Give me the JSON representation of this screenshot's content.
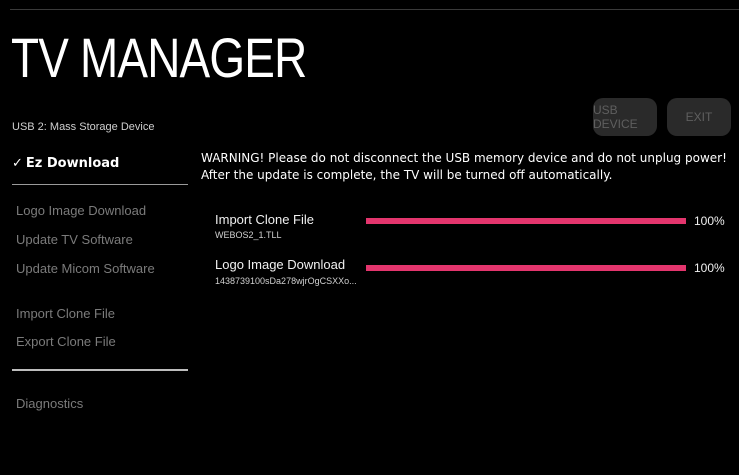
{
  "header": {
    "title": "TV MANAGER",
    "subtitle": "USB 2: Mass Storage Device"
  },
  "buttons": {
    "usb_device": "USB DEVICE",
    "exit": "EXIT"
  },
  "sidebar": {
    "active": {
      "check": "✓",
      "label": "Ez Download"
    },
    "items": [
      "Logo Image Download",
      "Update TV Software",
      "Update Micom Software",
      "Import Clone File",
      "Export Clone File",
      "Diagnostics"
    ]
  },
  "main": {
    "warning_line1": "WARNING! Please do not disconnect the USB memory device and do not unplug power!",
    "warning_line2": "After the update is complete, the TV will be turned off automatically.",
    "tasks": [
      {
        "label": "Import Clone File",
        "file": "WEBOS2_1.TLL",
        "progress": 1.0,
        "percent_text": "100%"
      },
      {
        "label": "Logo Image Download",
        "file": "1438739100sDa278wjrOgCSXXo...",
        "progress": 1.0,
        "percent_text": "100%"
      }
    ]
  },
  "colors": {
    "background": "#000000",
    "progress_fill": "#e3356d",
    "disabled_button_bg": "#2a2a2a"
  }
}
